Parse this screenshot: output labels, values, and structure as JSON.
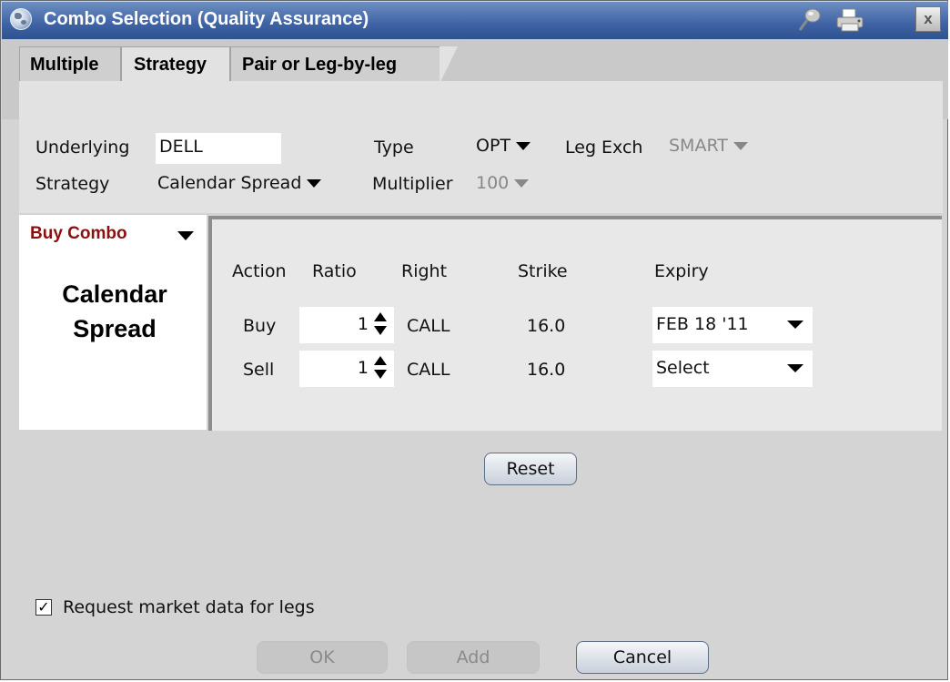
{
  "window": {
    "title": "Combo Selection (Quality Assurance)",
    "close_label": "x"
  },
  "tabs": [
    {
      "label": "Multiple",
      "active": false
    },
    {
      "label": "Strategy",
      "active": true
    },
    {
      "label": "Pair or Leg-by-leg",
      "active": false
    }
  ],
  "form": {
    "underlying_label": "Underlying",
    "underlying_value": "DELL",
    "type_label": "Type",
    "type_value": "OPT",
    "leg_exch_label": "Leg Exch",
    "leg_exch_value": "SMART",
    "strategy_label": "Strategy",
    "strategy_value": "Calendar Spread",
    "multiplier_label": "Multiplier",
    "multiplier_value": "100"
  },
  "combo": {
    "action_label": "Buy Combo",
    "strategy_line1": "Calendar",
    "strategy_line2": "Spread"
  },
  "legs": {
    "headers": {
      "action": "Action",
      "ratio": "Ratio",
      "right": "Right",
      "strike": "Strike",
      "expiry": "Expiry"
    },
    "rows": [
      {
        "action": "Buy",
        "ratio": "1",
        "right": "CALL",
        "strike": "16.0",
        "expiry": "FEB 18 '11"
      },
      {
        "action": "Sell",
        "ratio": "1",
        "right": "CALL",
        "strike": "16.0",
        "expiry": "Select"
      }
    ]
  },
  "buttons": {
    "reset": "Reset",
    "ok": "OK",
    "add": "Add",
    "cancel": "Cancel"
  },
  "request_market_data": {
    "label": "Request market data for legs",
    "checked": true,
    "check_glyph": "✓"
  },
  "colors": {
    "titlebar": "#3e62a4",
    "buy_combo_text": "#8b1010",
    "panel": "#e2e2e2"
  }
}
